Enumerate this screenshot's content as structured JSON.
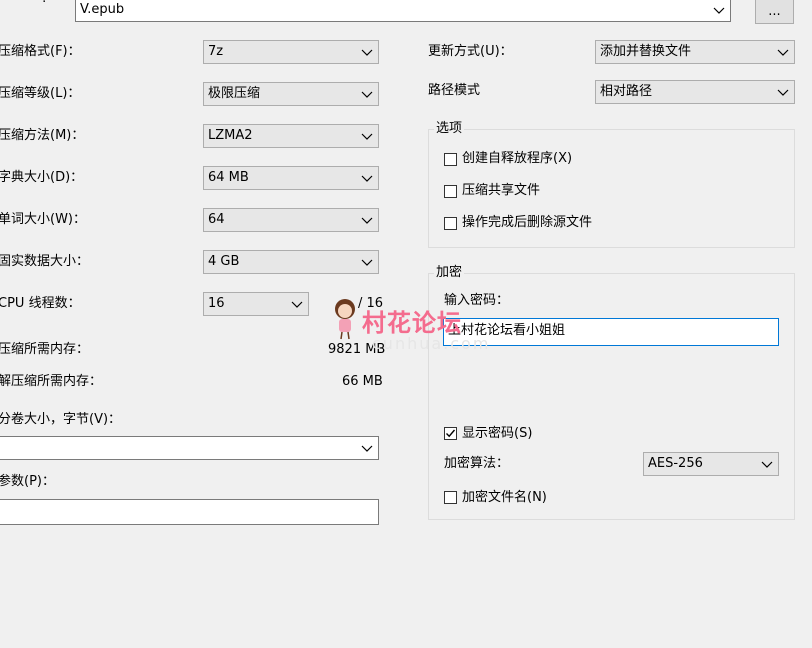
{
  "archive": {
    "path": "V.epub",
    "browse_label": "..."
  },
  "left": {
    "format": {
      "label": "压缩格式(F)：",
      "value": "7z"
    },
    "level": {
      "label": "压缩等级(L)：",
      "value": "极限压缩"
    },
    "method": {
      "label": "压缩方法(M)：",
      "value": "LZMA2"
    },
    "dictionary": {
      "label": "字典大小(D)：",
      "value": "64 MB"
    },
    "word": {
      "label": "单词大小(W)：",
      "value": "64"
    },
    "solid": {
      "label": "固实数据大小：",
      "value": "4 GB"
    },
    "cpu": {
      "label": "CPU 线程数：",
      "value": "16",
      "total": "/ 16"
    },
    "mem_compress": {
      "label": "压缩所需内存：",
      "value": "9821 MB"
    },
    "mem_decompress": {
      "label": "解压缩所需内存：",
      "value": "66 MB"
    },
    "volume": {
      "label": "分卷大小，字节(V)：",
      "value": ""
    },
    "params": {
      "label": "参数(P)：",
      "value": ""
    }
  },
  "right": {
    "update": {
      "label": "更新方式(U)：",
      "value": "添加并替换文件"
    },
    "path_mode": {
      "label": "路径模式",
      "value": "相对路径"
    },
    "options": {
      "title": "选项",
      "sfx": {
        "label": "创建自释放程序(X)",
        "checked": false
      },
      "shared": {
        "label": "压缩共享文件",
        "checked": false
      },
      "delete": {
        "label": "操作完成后删除源文件",
        "checked": false
      }
    },
    "encryption": {
      "title": "加密",
      "password_label": "输入密码：",
      "password_value": "上村花论坛看小姐姐",
      "show_password": {
        "label": "显示密码(S)",
        "checked": true
      },
      "method_label": "加密算法：",
      "method_value": "AES-256",
      "encrypt_names": {
        "label": "加密文件名(N)",
        "checked": false
      }
    }
  },
  "watermark": {
    "text": "村花论坛",
    "subtext": "cunhua.com"
  }
}
